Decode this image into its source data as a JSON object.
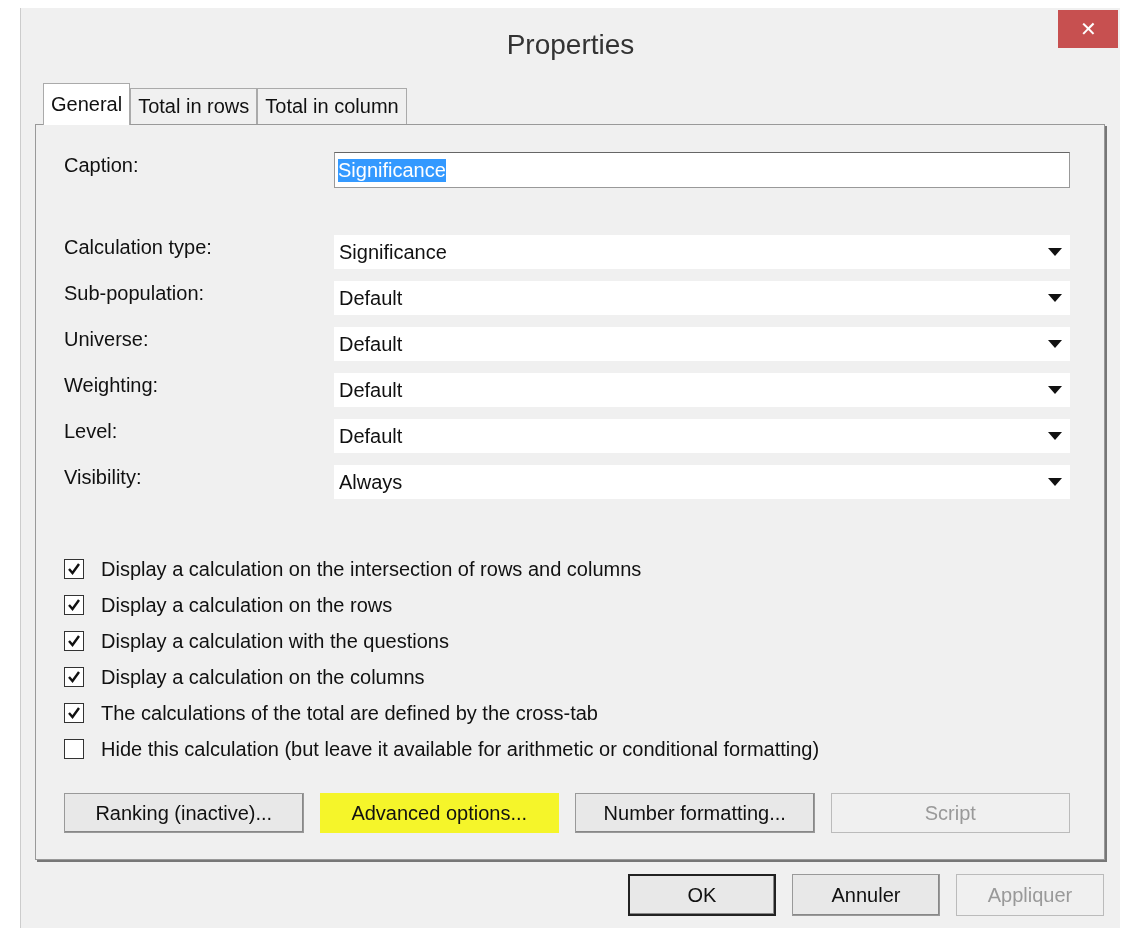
{
  "window": {
    "title": "Properties",
    "close": "✕"
  },
  "tabs": [
    {
      "label": "General",
      "selected": true
    },
    {
      "label": "Total in rows",
      "selected": false
    },
    {
      "label": "Total in column",
      "selected": false
    }
  ],
  "caption": {
    "label": "Caption:",
    "value": "Significance",
    "selected": true
  },
  "fields": [
    {
      "label": "Calculation type:",
      "value": "Significance"
    },
    {
      "label": "Sub-population:",
      "value": "Default"
    },
    {
      "label": "Universe:",
      "value": "Default"
    },
    {
      "label": "Weighting:",
      "value": "Default"
    },
    {
      "label": "Level:",
      "value": "Default"
    },
    {
      "label": "Visibility:",
      "value": "Always"
    }
  ],
  "checkboxes": [
    {
      "label": "Display a calculation on the intersection of rows and columns",
      "checked": true
    },
    {
      "label": "Display a calculation on the rows",
      "checked": true
    },
    {
      "label": "Display a calculation with the questions",
      "checked": true
    },
    {
      "label": "Display a calculation on the columns",
      "checked": true
    },
    {
      "label": "The calculations of the total are defined by the cross-tab",
      "checked": true
    },
    {
      "label": "Hide this calculation (but leave it available for arithmetic or conditional formatting)",
      "checked": false
    }
  ],
  "panel_buttons": [
    {
      "label": "Ranking (inactive)...",
      "disabled": false,
      "highlighted": false
    },
    {
      "label": "Advanced options...",
      "disabled": false,
      "highlighted": true
    },
    {
      "label": "Number formatting...",
      "disabled": false,
      "highlighted": false
    },
    {
      "label": "Script",
      "disabled": true,
      "highlighted": false
    }
  ],
  "dialog_buttons": [
    {
      "label": "OK",
      "disabled": false,
      "default": true
    },
    {
      "label": "Annuler",
      "disabled": false,
      "default": false
    },
    {
      "label": "Appliquer",
      "disabled": true,
      "default": false
    }
  ]
}
